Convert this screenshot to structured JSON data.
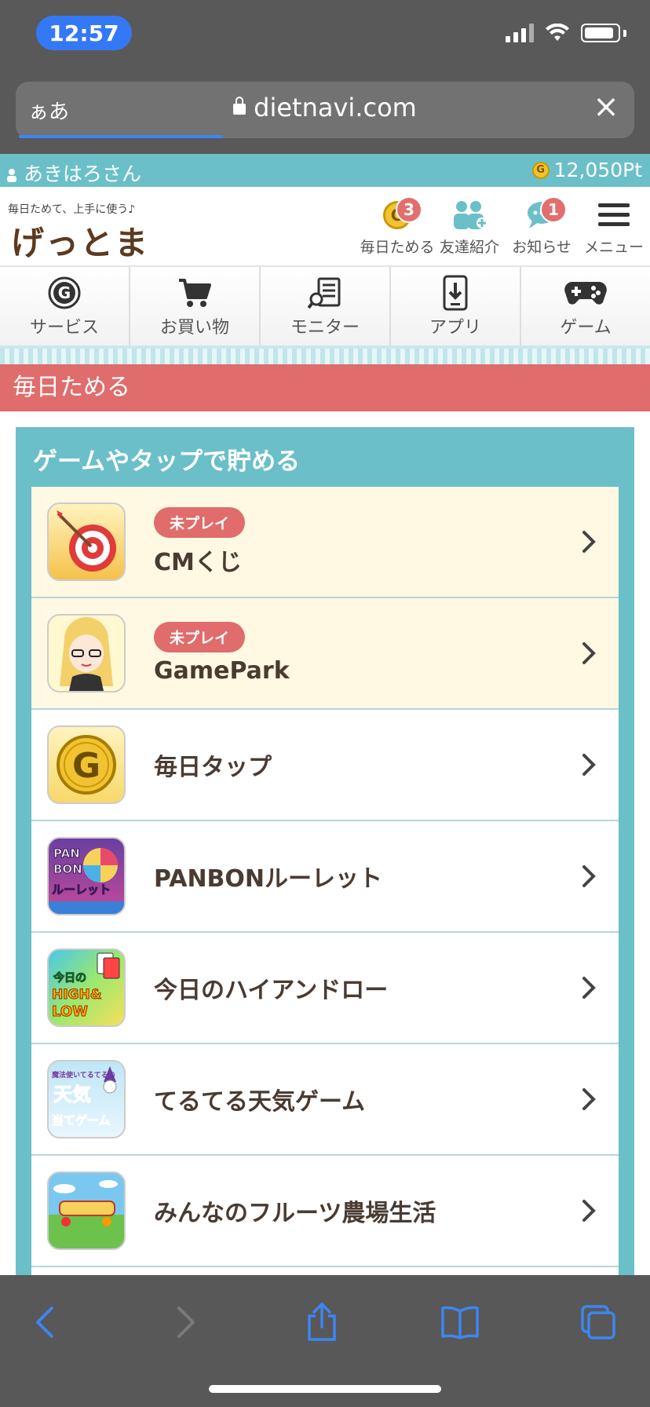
{
  "status": {
    "time": "12:57"
  },
  "browser": {
    "aa_label": "ぁあ",
    "url": "dietnavi.com",
    "page_load_progress": 0.33
  },
  "user": {
    "name": "あきはろさん",
    "points": "12,050Pt"
  },
  "logo": {
    "tagline": "毎日ためて、上手に使う♪",
    "name": "げっとま"
  },
  "header_nav": [
    {
      "label": "毎日ためる",
      "badge": "3",
      "icon": "g-coin-icon"
    },
    {
      "label": "友達紹介",
      "icon": "friends-icon"
    },
    {
      "label": "お知らせ",
      "badge": "1",
      "icon": "speech-bubble-icon"
    },
    {
      "label": "メニュー",
      "icon": "hamburger-menu-icon"
    }
  ],
  "categories": [
    {
      "label": "サービス",
      "icon": "g-circle-icon"
    },
    {
      "label": "お買い物",
      "icon": "cart-icon"
    },
    {
      "label": "モニター",
      "icon": "clipboard-search-icon"
    },
    {
      "label": "アプリ",
      "icon": "phone-download-icon"
    },
    {
      "label": "ゲーム",
      "icon": "gamepad-icon"
    }
  ],
  "section_title": "毎日ためる",
  "panel_title": "ゲームやタップで貯める",
  "items": [
    {
      "title": "CMくじ",
      "badge": "未プレイ",
      "icon": "dart-target-icon"
    },
    {
      "title": "GamePark",
      "badge": "未プレイ",
      "icon": "anime-girl-icon"
    },
    {
      "title": "毎日タップ",
      "icon": "g-coin-icon"
    },
    {
      "title": "PANBONルーレット",
      "icon": "panbon-roulette-icon",
      "icon_text": [
        "PAN",
        "BON",
        "ルーレット"
      ]
    },
    {
      "title": "今日のハイアンドロー",
      "icon": "high-low-icon",
      "icon_text": [
        "今日の",
        "HIGH&",
        "LOW"
      ]
    },
    {
      "title": "てるてる天気ゲーム",
      "icon": "weather-game-icon",
      "icon_text": [
        "魔法使いてるてるの",
        "天気",
        "当てゲーム"
      ]
    },
    {
      "title": "みんなのフルーツ農場生活",
      "icon": "fruit-farm-icon"
    }
  ],
  "colors": {
    "teal": "#6bbfc8",
    "salmon": "#e06c6c",
    "cream": "#fff8e2",
    "ios_blue": "#3c86f3"
  }
}
